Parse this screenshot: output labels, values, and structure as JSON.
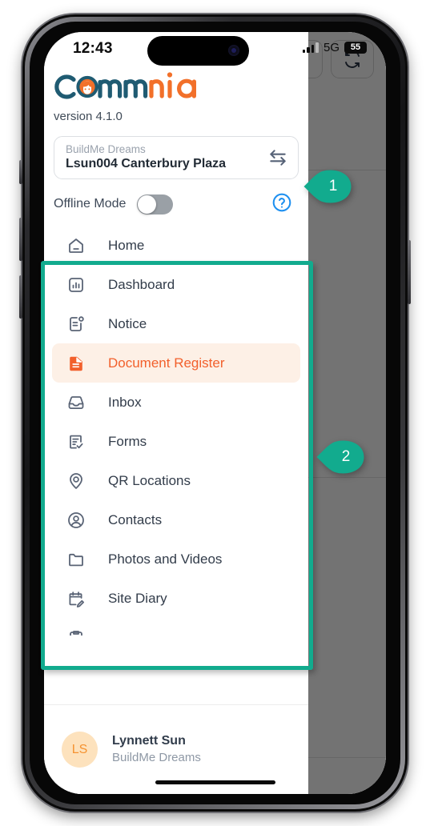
{
  "device": {
    "status_bar": {
      "time": "12:43",
      "network": "5G",
      "battery_level": "55",
      "signal_icon": "signal-bars-icon",
      "battery_icon": "battery-icon"
    },
    "home_indicator": "home-indicator"
  },
  "drawer": {
    "brand": {
      "logo_text": "commnia",
      "logo_text_part1": "c",
      "logo_text_part2": "mm",
      "logo_text_part3": "nia",
      "logo_color_dark": "#1f5b72",
      "logo_color_orange": "#f2702a",
      "version": "version 4.1.0"
    },
    "project_selector": {
      "company": "BuildMe Dreams",
      "project": "Lsun004 Canterbury Plaza",
      "swap_icon": "swap-arrows-icon"
    },
    "offline": {
      "label": "Offline Mode",
      "toggle_state": "off",
      "help_icon": "help-circle-icon",
      "help_color": "#1e90f0"
    },
    "menu": {
      "active_item": "Document Register",
      "active_text_color": "#f2602c",
      "active_bg_color": "#fdf0e6",
      "items": [
        {
          "label": "Home",
          "icon": "home-icon"
        },
        {
          "label": "Dashboard",
          "icon": "chart-bar-icon"
        },
        {
          "label": "Notice",
          "icon": "notice-document-icon"
        },
        {
          "label": "Document Register",
          "icon": "document-file-icon"
        },
        {
          "label": "Inbox",
          "icon": "inbox-icon"
        },
        {
          "label": "Forms",
          "icon": "form-check-icon"
        },
        {
          "label": "QR Locations",
          "icon": "map-pin-icon"
        },
        {
          "label": "Contacts",
          "icon": "user-circle-icon"
        },
        {
          "label": "Photos and Videos",
          "icon": "folder-icon"
        },
        {
          "label": "Site Diary",
          "icon": "calendar-edit-icon"
        }
      ]
    },
    "user": {
      "initials": "LS",
      "name": "Lynnett Sun",
      "organisation": "BuildMe Dreams",
      "avatar_bg": "#fde2bd",
      "avatar_color": "#f59331"
    }
  },
  "background_page": {
    "sync_button_icon": "sync-refresh-icon"
  },
  "annotations": {
    "accent_color": "#12ab8e",
    "callouts": [
      {
        "number": "1",
        "target": "project-selector"
      },
      {
        "number": "2",
        "target": "menu-list"
      }
    ],
    "highlight_box_target": "menu-list"
  }
}
